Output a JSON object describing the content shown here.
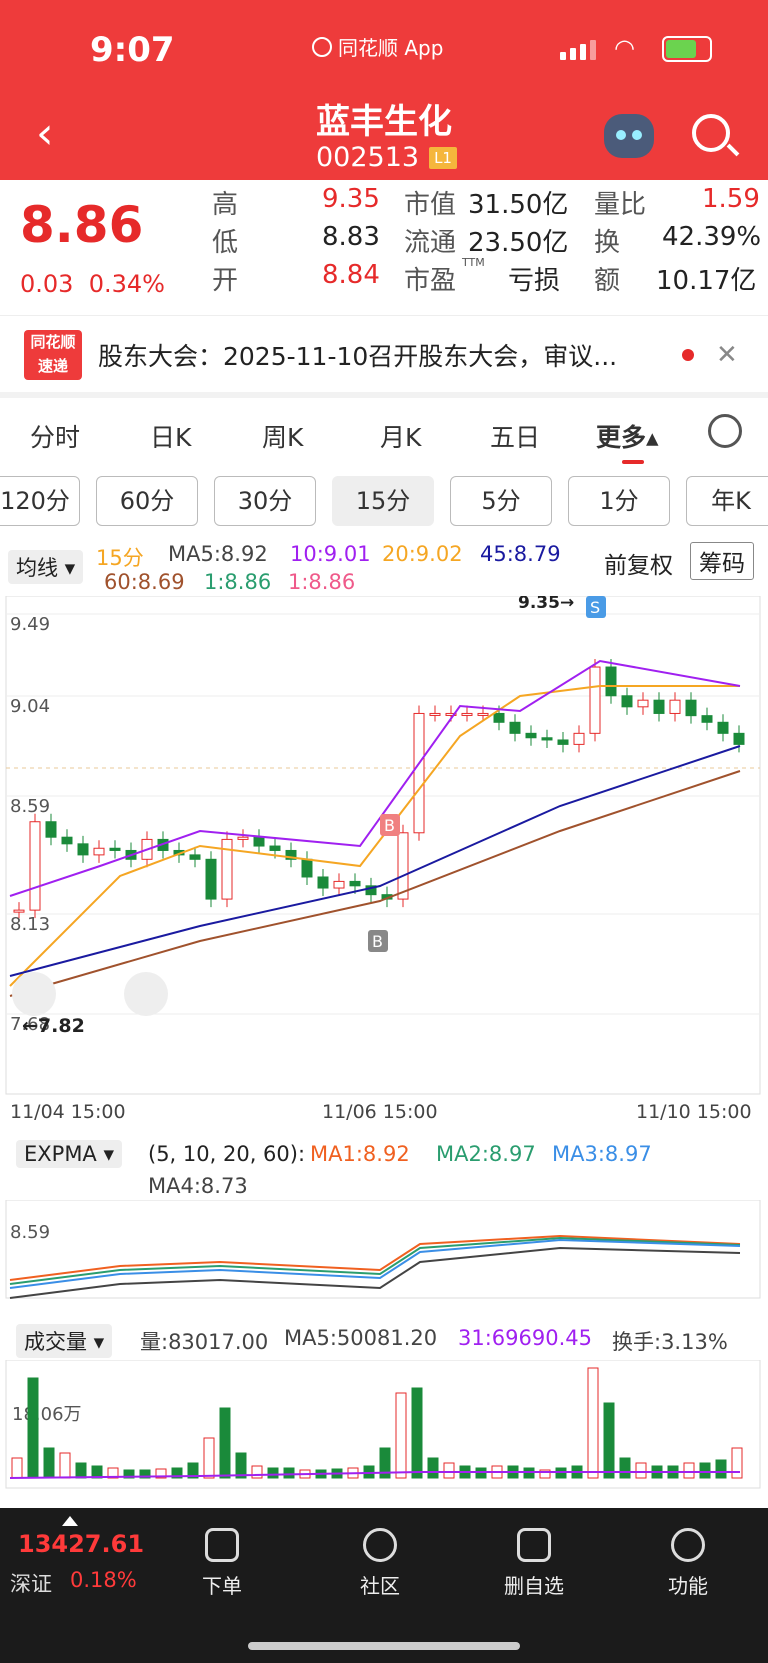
{
  "status": {
    "time": "9:07",
    "app": "同花顺 App"
  },
  "header": {
    "title": "蓝丰生化",
    "code": "002513",
    "level": "L1"
  },
  "quote": {
    "price": "8.86",
    "change": "0.03",
    "change_pct": "0.34%",
    "high_label": "高",
    "high": "9.35",
    "low_label": "低",
    "low": "8.83",
    "open_label": "开",
    "open": "8.84",
    "mcap_label": "市值",
    "mcap": "31.50亿",
    "float_label": "流通",
    "float": "23.50亿",
    "pe_label": "市盈",
    "pe_sup": "TTM",
    "pe": "亏损",
    "vr_label": "量比",
    "vr": "1.59",
    "turn_label": "换",
    "turn": "42.39%",
    "amt_label": "额",
    "amt": "10.17亿"
  },
  "news": {
    "badge1": "同花顺",
    "badge2": "速递",
    "text": "股东大会：2025-11-10召开股东大会，审议..."
  },
  "tabs": [
    "分时",
    "日K",
    "周K",
    "月K",
    "五日",
    "更多▴"
  ],
  "periods": [
    "120分",
    "60分",
    "30分",
    "15分",
    "5分",
    "1分",
    "年K"
  ],
  "ma_line": {
    "selector": "均线 ▾",
    "period": "15分",
    "ma5": "MA5:8.92",
    "ma10": "10:9.01",
    "ma20": "20:9.02",
    "ma45": "45:8.79",
    "ma60": "60:8.69",
    "ma1a": "1:8.86",
    "ma1b": "1:8.86",
    "fuquan": "前复权",
    "chouma": "筹码"
  },
  "main_chart": {
    "y_ticks": [
      "9.49",
      "9.04",
      "8.59",
      "8.13",
      "7.68"
    ],
    "x_ticks": [
      "11/04 15:00",
      "11/06 15:00",
      "11/10 15:00"
    ],
    "high_mark": "9.35→",
    "low_mark": "←7.82",
    "sell": "S",
    "buy": "B",
    "buy2": "B"
  },
  "expma": {
    "selector": "EXPMA ▾",
    "params": "(5, 10, 20, 60):",
    "ma1": "MA1:8.92",
    "ma2": "MA2:8.97",
    "ma3": "MA3:8.97",
    "ma4": "MA4:8.73",
    "y_tick": "8.59"
  },
  "volume": {
    "selector": "成交量 ▾",
    "vol": "量:83017.00",
    "ma5": "MA5:50081.20",
    "ma31": "31:69690.45",
    "turnover": "换手:3.13%",
    "y_tick": "18.06万"
  },
  "bottom": {
    "index": "13427.61",
    "index_name": "深证",
    "index_pct": "0.18%",
    "nav": [
      "下单",
      "社区",
      "删自选",
      "功能"
    ]
  },
  "chart_data": {
    "type": "candlestick",
    "title": "",
    "ylim": [
      7.68,
      9.49
    ],
    "high": 9.35,
    "low": 7.82,
    "x_ticks": [
      "11/04 15:00",
      "11/06 15:00",
      "11/10 15:00"
    ]
  }
}
